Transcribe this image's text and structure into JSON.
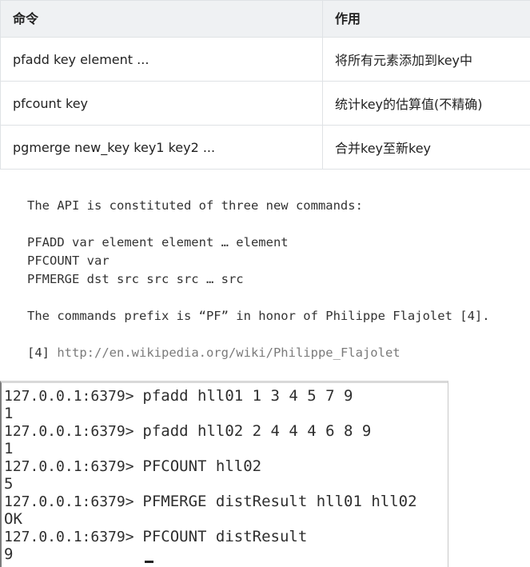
{
  "table": {
    "headers": [
      "命令",
      "作用"
    ],
    "rows": [
      [
        "pfadd key element ...",
        "将所有元素添加到key中"
      ],
      [
        "pfcount key",
        "统计key的估算值(不精确)"
      ],
      [
        "pgmerge new_key key1 key2 ...",
        "合并key至新key"
      ]
    ]
  },
  "doc": {
    "intro": "The API is constituted of three new commands:",
    "commands": [
      "PFADD var element element … element",
      "PFCOUNT var",
      "PFMERGE dst src src src … src"
    ],
    "prefix_note": "The commands prefix is “PF” in honor of Philippe Flajolet [4].",
    "ref_label": "[4]",
    "ref_url": "http://en.wikipedia.org/wiki/Philippe_Flajolet"
  },
  "terminal": {
    "lines": [
      {
        "prompt": "127.0.0.1:6379> ",
        "command": "pfadd hll01 1 3 4 5 7 9"
      },
      {
        "output": "1"
      },
      {
        "prompt": "127.0.0.1:6379> ",
        "command": "pfadd hll02 2 4 4 4 6 8 9"
      },
      {
        "output": "1"
      },
      {
        "prompt": "127.0.0.1:6379> ",
        "command": "PFCOUNT hll02"
      },
      {
        "output": "5"
      },
      {
        "prompt": "127.0.0.1:6379> ",
        "command": "PFMERGE distResult hll01 hll02"
      },
      {
        "output": "OK"
      },
      {
        "prompt": "127.0.0.1:6379> ",
        "command": "PFCOUNT distResult"
      },
      {
        "output": "9"
      }
    ]
  }
}
